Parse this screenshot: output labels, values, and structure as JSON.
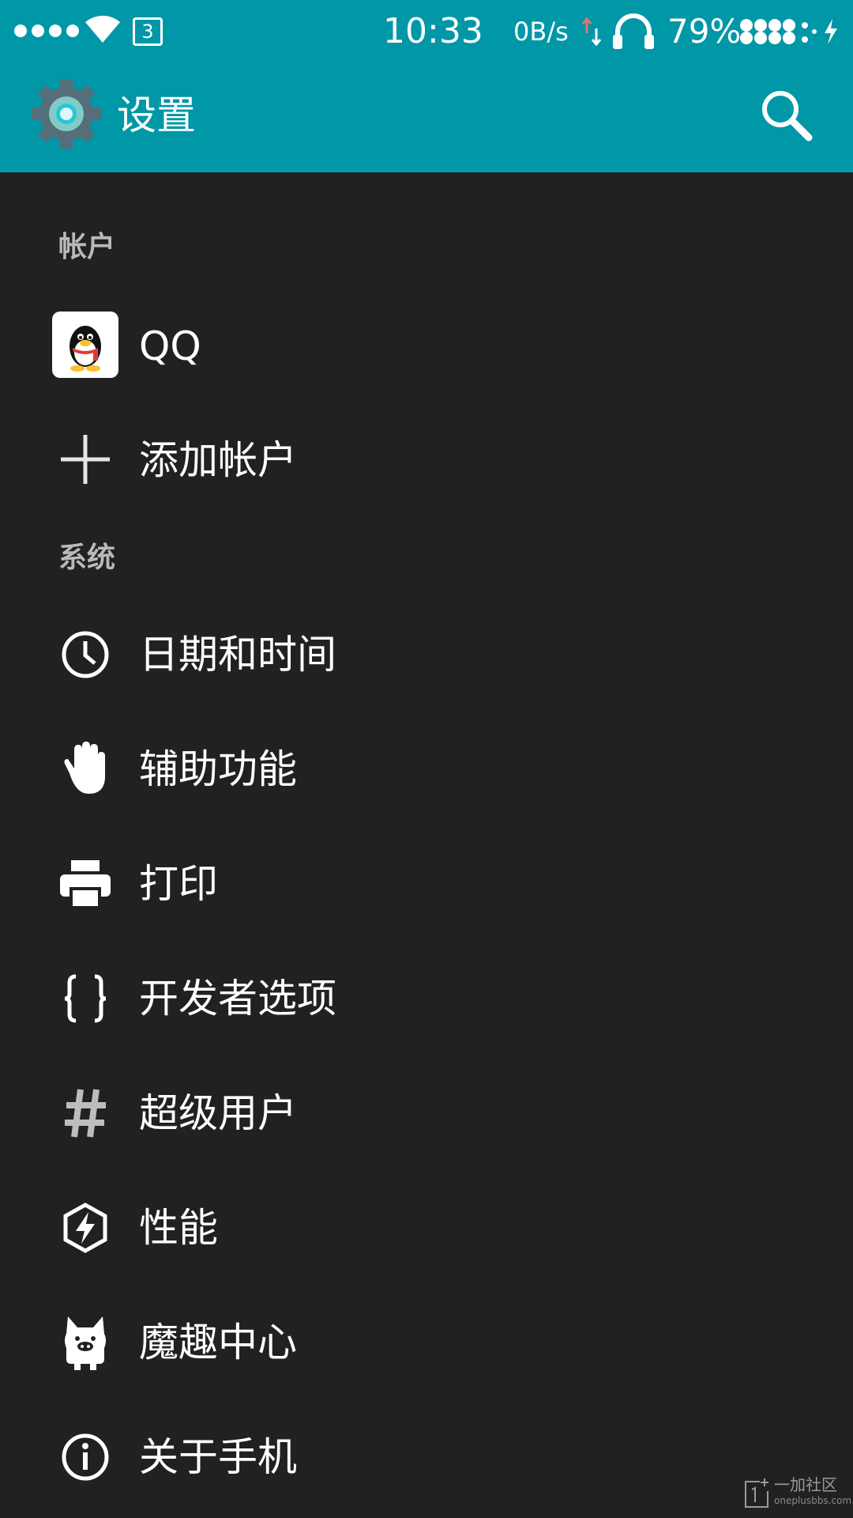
{
  "status_bar": {
    "sim_slot": "3",
    "time": "10:33",
    "net_speed": "0B/s",
    "battery": "79%"
  },
  "app_bar": {
    "title": "设置",
    "accent_color": "#0097a7"
  },
  "sections": [
    {
      "header": "帐户",
      "items": [
        {
          "label": "QQ",
          "icon": "qq-penguin-icon"
        },
        {
          "label": "添加帐户",
          "icon": "plus-icon"
        }
      ]
    },
    {
      "header": "系统",
      "items": [
        {
          "label": "日期和时间",
          "icon": "clock-icon"
        },
        {
          "label": "辅助功能",
          "icon": "hand-icon"
        },
        {
          "label": "打印",
          "icon": "printer-icon"
        },
        {
          "label": "开发者选项",
          "icon": "braces-icon"
        },
        {
          "label": "超级用户",
          "icon": "hash-icon"
        },
        {
          "label": "性能",
          "icon": "lightning-icon"
        },
        {
          "label": "魔趣中心",
          "icon": "pig-mascot-icon"
        },
        {
          "label": "关于手机",
          "icon": "info-icon"
        }
      ]
    }
  ],
  "watermark": {
    "text": "一加社区",
    "subtext": "oneplusbbs.com"
  }
}
